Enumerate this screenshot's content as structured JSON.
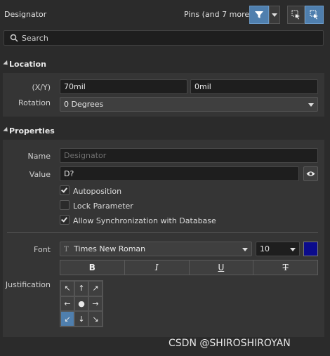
{
  "header": {
    "title": "Designator",
    "filter_summary": "Pins (and 7 more)"
  },
  "search": {
    "placeholder": "Search"
  },
  "location": {
    "section_label": "Location",
    "xy_label": "(X/Y)",
    "x_value": "70mil",
    "y_value": "0mil",
    "rotation_label": "Rotation",
    "rotation_value": "0 Degrees"
  },
  "properties": {
    "section_label": "Properties",
    "name_label": "Name",
    "name_placeholder": "Designator",
    "value_label": "Value",
    "value_value": "D?",
    "autoposition_label": "Autoposition",
    "autoposition_checked": true,
    "lock_parameter_label": "Lock Parameter",
    "lock_parameter_checked": false,
    "allow_sync_label": "Allow Synchronization with Database",
    "allow_sync_checked": true,
    "font_label": "Font",
    "font_value": "Times New Roman",
    "font_size": "10",
    "font_color": "#0b0b8c",
    "style_buttons": [
      "B",
      "I",
      "U",
      "T"
    ],
    "justification_label": "Justification",
    "justification_cells": [
      "↖",
      "↑",
      "↗",
      "←",
      "●",
      "→",
      "↙",
      "↓",
      "↘"
    ],
    "justification_selected": 6
  },
  "watermark": "CSDN @SHIROSHIROYAN"
}
